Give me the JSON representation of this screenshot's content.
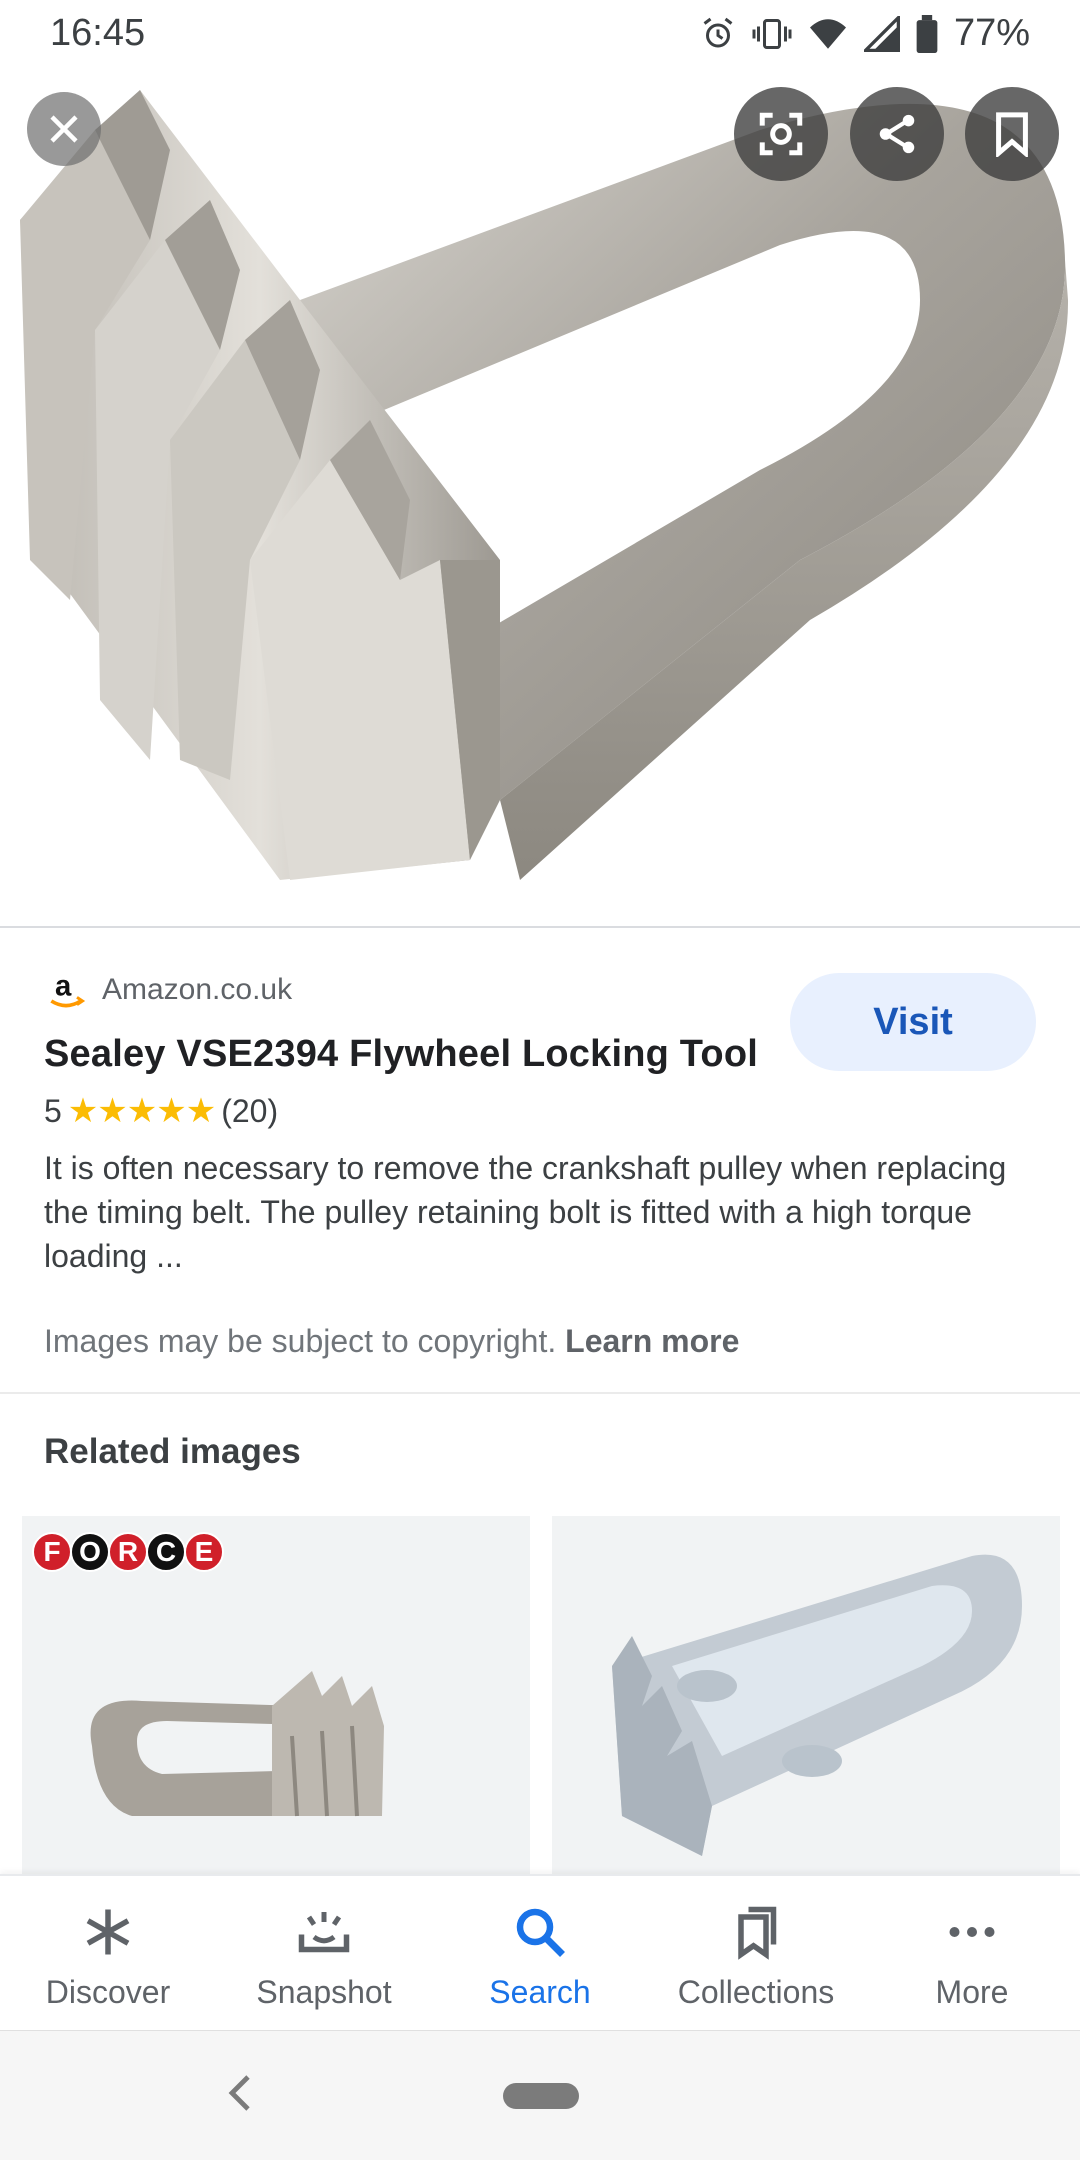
{
  "status_bar": {
    "time": "16:45",
    "battery": "77%",
    "icons": [
      "alarm-icon",
      "vibrate-icon",
      "wifi-icon",
      "signal-icon",
      "battery-icon"
    ]
  },
  "hero": {
    "image": "flywheel-locking-tool-photo",
    "actions": [
      "close-icon",
      "lens-icon",
      "share-icon",
      "bookmark-icon"
    ]
  },
  "result": {
    "source": "Amazon.co.uk",
    "visit_label": "Visit",
    "title": "Sealey VSE2394 Flywheel Locking Tool",
    "rating_value": "5",
    "stars": "★★★★★",
    "rating_count": "(20)",
    "description": "It is often necessary to remove the crankshaft pulley when replacing the timing belt. The pulley retaining bolt is fitted with a high torque loading ...",
    "copyright_text": "Images may be subject to copyright.",
    "learn_more": "Learn more"
  },
  "related": {
    "heading": "Related images",
    "force_logo_letters": [
      "F",
      "O",
      "R",
      "C",
      "E"
    ]
  },
  "bottom_nav": {
    "items": [
      {
        "label": "Discover",
        "icon": "asterisk-icon",
        "active": false
      },
      {
        "label": "Snapshot",
        "icon": "snapshot-icon",
        "active": false
      },
      {
        "label": "Search",
        "icon": "search-icon",
        "active": true
      },
      {
        "label": "Collections",
        "icon": "collections-icon",
        "active": false
      },
      {
        "label": "More",
        "icon": "more-icon",
        "active": false
      }
    ]
  },
  "colors": {
    "accent": "#1a73e8",
    "visit_bg": "#e8f0fe",
    "star": "#fbbc04"
  }
}
